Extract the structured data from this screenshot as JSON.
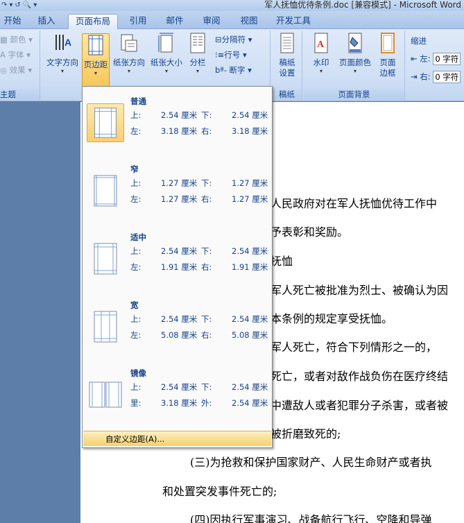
{
  "window": {
    "title": "军人抚恤优待条例.doc [兼容模式] - Microsoft Word"
  },
  "tabs": [
    {
      "label": "开始"
    },
    {
      "label": "插入"
    },
    {
      "label": "页面布局",
      "active": true
    },
    {
      "label": "引用"
    },
    {
      "label": "邮件"
    },
    {
      "label": "审阅"
    },
    {
      "label": "视图"
    },
    {
      "label": "开发工具"
    }
  ],
  "ribbon": {
    "theme": {
      "colors": "颜色",
      "fonts": "字体",
      "effects": "效果",
      "group": "主题"
    },
    "page_setup": {
      "text_direction": "文字方向",
      "margins": "页边距",
      "orientation": "纸张方向",
      "size": "纸张大小",
      "columns": "分栏",
      "breaks": "分隔符",
      "line_numbers": "行号",
      "hyphenation": "断字"
    },
    "draft": {
      "draft_settings": [
        "稿纸",
        "设置"
      ],
      "group": "稿纸"
    },
    "page_background": {
      "watermark": "水印",
      "page_color": "页面颜色",
      "page_borders": [
        "页面",
        "边框"
      ],
      "group": "页面背景"
    },
    "paragraph": {
      "indent_title": "缩进",
      "left_label": "左:",
      "right_label": "右:",
      "left_value": "0 字符",
      "right_value": "0 字符"
    }
  },
  "margins_menu": {
    "options": [
      {
        "name": "普通",
        "top": "2.54 厘米",
        "bottom": "2.54 厘米",
        "left": "3.18 厘米",
        "right": "3.18 厘米",
        "l1a": "上:",
        "l1b": "下:",
        "l2a": "左:",
        "l2b": "右:"
      },
      {
        "name": "窄",
        "top": "1.27 厘米",
        "bottom": "1.27 厘米",
        "left": "1.27 厘米",
        "right": "1.27 厘米",
        "l1a": "上:",
        "l1b": "下:",
        "l2a": "左:",
        "l2b": "右:"
      },
      {
        "name": "适中",
        "top": "2.54 厘米",
        "bottom": "2.54 厘米",
        "left": "1.91 厘米",
        "right": "1.91 厘米",
        "l1a": "上:",
        "l1b": "下:",
        "l2a": "左:",
        "l2b": "右:"
      },
      {
        "name": "宽",
        "top": "2.54 厘米",
        "bottom": "2.54 厘米",
        "left": "5.08 厘米",
        "right": "5.08 厘米",
        "l1a": "上:",
        "l1b": "下:",
        "l2a": "左:",
        "l2b": "右:"
      },
      {
        "name": "镜像",
        "top": "2.54 厘米",
        "bottom": "2.54 厘米",
        "left": "3.18 厘米",
        "right": "2.54 厘米",
        "l1a": "上:",
        "l1b": "下:",
        "l2a": "里:",
        "l2b": "外:"
      }
    ],
    "custom": "自定义边距(A)..."
  },
  "document": {
    "lines": [
      "人民政府对在军人抚恤优待工作中",
      "予表彰和奖励。",
      "抚恤",
      "军人死亡被批准为烈士、被确认为因",
      "本条例的规定享受抚恤。",
      "军人死亡，符合下列情形之一的，",
      "死亡，或者对敌作战负伤在医疗终结",
      "中遭敌人或者犯罪分子杀害，或者被",
      "被折磨致死的;",
      "(三)为抢救和保护国家财产、人民生命财产或者执",
      "和处置突发事件死亡的;",
      "(四)因执行军事演习、战备航行飞行、空降和导弹"
    ]
  }
}
